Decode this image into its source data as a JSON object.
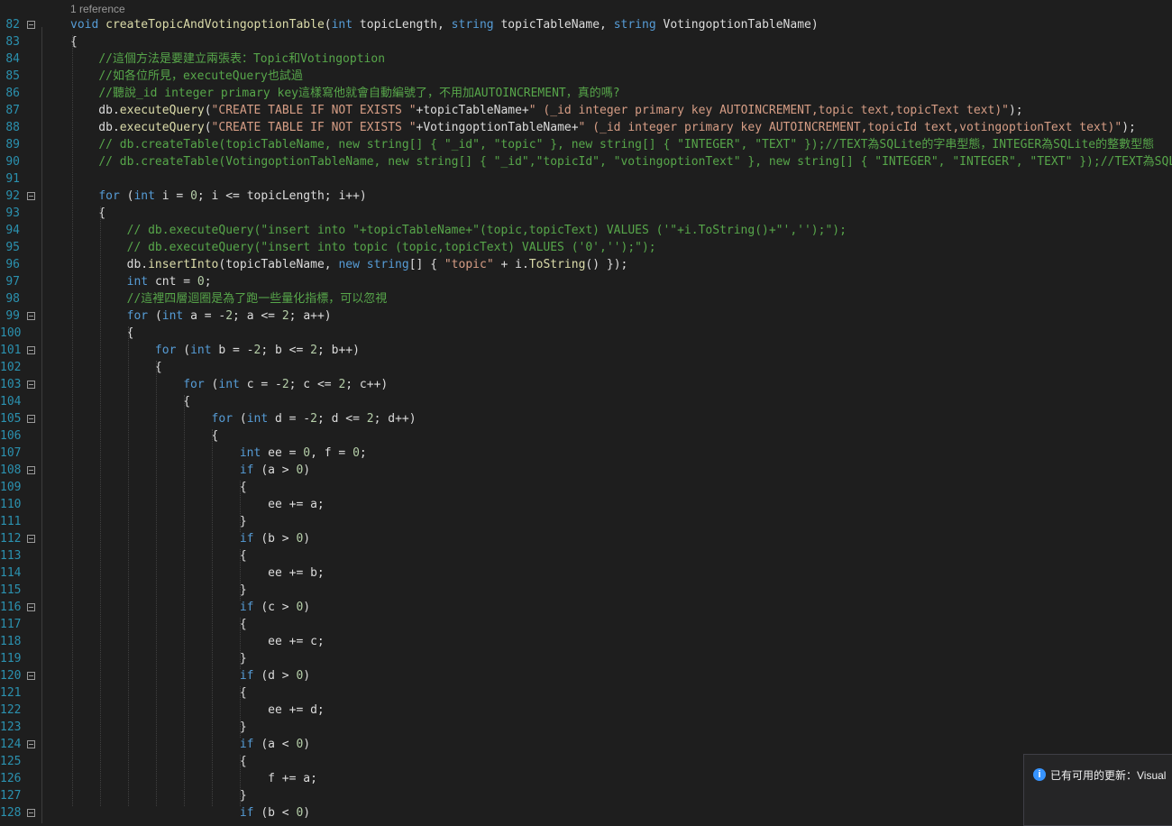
{
  "codelens": "1 reference",
  "icons": {
    "fold": "collapse-minus-icon",
    "info": "info-icon"
  },
  "notification": {
    "text": "已有可用的更新：Visual"
  },
  "lines": [
    {
      "num": "82",
      "fold": true,
      "tokens": [
        {
          "k": "k",
          "t": "void "
        },
        {
          "k": "m",
          "t": "createTopicAndVotingoptionTable"
        },
        {
          "k": "i",
          "t": "("
        },
        {
          "k": "k",
          "t": "int "
        },
        {
          "k": "i",
          "t": "topicLength, "
        },
        {
          "k": "k",
          "t": "string "
        },
        {
          "k": "i",
          "t": "topicTableName, "
        },
        {
          "k": "k",
          "t": "string "
        },
        {
          "k": "i",
          "t": "VotingoptionTableName)"
        }
      ]
    },
    {
      "num": "83",
      "fold": false,
      "tokens": [
        {
          "k": "i",
          "t": "{"
        }
      ]
    },
    {
      "num": "84",
      "fold": false,
      "tokens": [
        {
          "k": "i",
          "t": "    "
        },
        {
          "k": "c",
          "t": "//這個方法是要建立兩張表：Topic和Votingoption"
        }
      ]
    },
    {
      "num": "85",
      "fold": false,
      "tokens": [
        {
          "k": "i",
          "t": "    "
        },
        {
          "k": "c",
          "t": "//如各位所見，executeQuery也試過"
        }
      ]
    },
    {
      "num": "86",
      "fold": false,
      "tokens": [
        {
          "k": "i",
          "t": "    "
        },
        {
          "k": "c",
          "t": "//聽說_id integer primary key這樣寫他就會自動編號了，不用加AUTOINCREMENT，真的嗎?"
        }
      ]
    },
    {
      "num": "87",
      "fold": false,
      "tokens": [
        {
          "k": "i",
          "t": "    db."
        },
        {
          "k": "m",
          "t": "executeQuery"
        },
        {
          "k": "i",
          "t": "("
        },
        {
          "k": "s",
          "t": "\"CREATE TABLE IF NOT EXISTS \""
        },
        {
          "k": "i",
          "t": "+topicTableName+"
        },
        {
          "k": "s",
          "t": "\" (_id integer primary key AUTOINCREMENT,topic text,topicText text)\""
        },
        {
          "k": "i",
          "t": ");"
        }
      ]
    },
    {
      "num": "88",
      "fold": false,
      "tokens": [
        {
          "k": "i",
          "t": "    db."
        },
        {
          "k": "m",
          "t": "executeQuery"
        },
        {
          "k": "i",
          "t": "("
        },
        {
          "k": "s",
          "t": "\"CREATE TABLE IF NOT EXISTS \""
        },
        {
          "k": "i",
          "t": "+VotingoptionTableName+"
        },
        {
          "k": "s",
          "t": "\" (_id integer primary key AUTOINCREMENT,topicId text,votingoptionText text)\""
        },
        {
          "k": "i",
          "t": ");"
        }
      ]
    },
    {
      "num": "89",
      "fold": false,
      "tokens": [
        {
          "k": "i",
          "t": "    "
        },
        {
          "k": "c",
          "t": "// db.createTable(topicTableName, new string[] { \"_id\", \"topic\" }, new string[] { \"INTEGER\", \"TEXT\" });//TEXT為SQLite的字串型態，INTEGER為SQLite的整數型態"
        }
      ]
    },
    {
      "num": "90",
      "fold": false,
      "tokens": [
        {
          "k": "i",
          "t": "    "
        },
        {
          "k": "c",
          "t": "// db.createTable(VotingoptionTableName, new string[] { \"_id\",\"topicId\", \"votingoptionText\" }, new string[] { \"INTEGER\", \"INTEGER\", \"TEXT\" });//TEXT為SQLite"
        }
      ]
    },
    {
      "num": "91",
      "fold": false,
      "tokens": []
    },
    {
      "num": "92",
      "fold": true,
      "tokens": [
        {
          "k": "i",
          "t": "    "
        },
        {
          "k": "k",
          "t": "for "
        },
        {
          "k": "i",
          "t": "("
        },
        {
          "k": "k",
          "t": "int "
        },
        {
          "k": "i",
          "t": "i = "
        },
        {
          "k": "n",
          "t": "0"
        },
        {
          "k": "i",
          "t": "; i <= topicLength; i++)"
        }
      ]
    },
    {
      "num": "93",
      "fold": false,
      "tokens": [
        {
          "k": "i",
          "t": "    {"
        }
      ]
    },
    {
      "num": "94",
      "fold": false,
      "tokens": [
        {
          "k": "i",
          "t": "        "
        },
        {
          "k": "c",
          "t": "// db.executeQuery(\"insert into \"+topicTableName+\"(topic,topicText) VALUES ('\"+i.ToString()+\"','');\");"
        }
      ]
    },
    {
      "num": "95",
      "fold": false,
      "tokens": [
        {
          "k": "i",
          "t": "        "
        },
        {
          "k": "c",
          "t": "// db.executeQuery(\"insert into topic (topic,topicText) VALUES ('0','');\");"
        }
      ]
    },
    {
      "num": "96",
      "fold": false,
      "tokens": [
        {
          "k": "i",
          "t": "        db."
        },
        {
          "k": "m",
          "t": "insertInto"
        },
        {
          "k": "i",
          "t": "(topicTableName, "
        },
        {
          "k": "k",
          "t": "new string"
        },
        {
          "k": "i",
          "t": "[] { "
        },
        {
          "k": "s",
          "t": "\"topic\""
        },
        {
          "k": "i",
          "t": " + i."
        },
        {
          "k": "m",
          "t": "ToString"
        },
        {
          "k": "i",
          "t": "() });"
        }
      ]
    },
    {
      "num": "97",
      "fold": false,
      "tokens": [
        {
          "k": "i",
          "t": "        "
        },
        {
          "k": "k",
          "t": "int "
        },
        {
          "k": "i",
          "t": "cnt = "
        },
        {
          "k": "n",
          "t": "0"
        },
        {
          "k": "i",
          "t": ";"
        }
      ]
    },
    {
      "num": "98",
      "fold": false,
      "tokens": [
        {
          "k": "i",
          "t": "        "
        },
        {
          "k": "c",
          "t": "//這裡四層迴圈是為了跑一些量化指標，可以忽視"
        }
      ]
    },
    {
      "num": "99",
      "fold": true,
      "tokens": [
        {
          "k": "i",
          "t": "        "
        },
        {
          "k": "k",
          "t": "for "
        },
        {
          "k": "i",
          "t": "("
        },
        {
          "k": "k",
          "t": "int "
        },
        {
          "k": "i",
          "t": "a = -"
        },
        {
          "k": "n",
          "t": "2"
        },
        {
          "k": "i",
          "t": "; a <= "
        },
        {
          "k": "n",
          "t": "2"
        },
        {
          "k": "i",
          "t": "; a++)"
        }
      ]
    },
    {
      "num": "100",
      "fold": false,
      "tokens": [
        {
          "k": "i",
          "t": "        {"
        }
      ]
    },
    {
      "num": "101",
      "fold": true,
      "tokens": [
        {
          "k": "i",
          "t": "            "
        },
        {
          "k": "k",
          "t": "for "
        },
        {
          "k": "i",
          "t": "("
        },
        {
          "k": "k",
          "t": "int "
        },
        {
          "k": "i",
          "t": "b = -"
        },
        {
          "k": "n",
          "t": "2"
        },
        {
          "k": "i",
          "t": "; b <= "
        },
        {
          "k": "n",
          "t": "2"
        },
        {
          "k": "i",
          "t": "; b++)"
        }
      ]
    },
    {
      "num": "102",
      "fold": false,
      "tokens": [
        {
          "k": "i",
          "t": "            {"
        }
      ]
    },
    {
      "num": "103",
      "fold": true,
      "tokens": [
        {
          "k": "i",
          "t": "                "
        },
        {
          "k": "k",
          "t": "for "
        },
        {
          "k": "i",
          "t": "("
        },
        {
          "k": "k",
          "t": "int "
        },
        {
          "k": "i",
          "t": "c = -"
        },
        {
          "k": "n",
          "t": "2"
        },
        {
          "k": "i",
          "t": "; c <= "
        },
        {
          "k": "n",
          "t": "2"
        },
        {
          "k": "i",
          "t": "; c++)"
        }
      ]
    },
    {
      "num": "104",
      "fold": false,
      "tokens": [
        {
          "k": "i",
          "t": "                {"
        }
      ]
    },
    {
      "num": "105",
      "fold": true,
      "tokens": [
        {
          "k": "i",
          "t": "                    "
        },
        {
          "k": "k",
          "t": "for "
        },
        {
          "k": "i",
          "t": "("
        },
        {
          "k": "k",
          "t": "int "
        },
        {
          "k": "i",
          "t": "d = -"
        },
        {
          "k": "n",
          "t": "2"
        },
        {
          "k": "i",
          "t": "; d <= "
        },
        {
          "k": "n",
          "t": "2"
        },
        {
          "k": "i",
          "t": "; d++)"
        }
      ]
    },
    {
      "num": "106",
      "fold": false,
      "tokens": [
        {
          "k": "i",
          "t": "                    {"
        }
      ]
    },
    {
      "num": "107",
      "fold": false,
      "tokens": [
        {
          "k": "i",
          "t": "                        "
        },
        {
          "k": "k",
          "t": "int "
        },
        {
          "k": "i",
          "t": "ee = "
        },
        {
          "k": "n",
          "t": "0"
        },
        {
          "k": "i",
          "t": ", f = "
        },
        {
          "k": "n",
          "t": "0"
        },
        {
          "k": "i",
          "t": ";"
        }
      ]
    },
    {
      "num": "108",
      "fold": true,
      "tokens": [
        {
          "k": "i",
          "t": "                        "
        },
        {
          "k": "k",
          "t": "if "
        },
        {
          "k": "i",
          "t": "(a > "
        },
        {
          "k": "n",
          "t": "0"
        },
        {
          "k": "i",
          "t": ")"
        }
      ]
    },
    {
      "num": "109",
      "fold": false,
      "tokens": [
        {
          "k": "i",
          "t": "                        {"
        }
      ]
    },
    {
      "num": "110",
      "fold": false,
      "tokens": [
        {
          "k": "i",
          "t": "                            ee += a;"
        }
      ]
    },
    {
      "num": "111",
      "fold": false,
      "tokens": [
        {
          "k": "i",
          "t": "                        }"
        }
      ]
    },
    {
      "num": "112",
      "fold": true,
      "tokens": [
        {
          "k": "i",
          "t": "                        "
        },
        {
          "k": "k",
          "t": "if "
        },
        {
          "k": "i",
          "t": "(b > "
        },
        {
          "k": "n",
          "t": "0"
        },
        {
          "k": "i",
          "t": ")"
        }
      ]
    },
    {
      "num": "113",
      "fold": false,
      "tokens": [
        {
          "k": "i",
          "t": "                        {"
        }
      ]
    },
    {
      "num": "114",
      "fold": false,
      "tokens": [
        {
          "k": "i",
          "t": "                            ee += b;"
        }
      ]
    },
    {
      "num": "115",
      "fold": false,
      "tokens": [
        {
          "k": "i",
          "t": "                        }"
        }
      ]
    },
    {
      "num": "116",
      "fold": true,
      "tokens": [
        {
          "k": "i",
          "t": "                        "
        },
        {
          "k": "k",
          "t": "if "
        },
        {
          "k": "i",
          "t": "(c > "
        },
        {
          "k": "n",
          "t": "0"
        },
        {
          "k": "i",
          "t": ")"
        }
      ]
    },
    {
      "num": "117",
      "fold": false,
      "tokens": [
        {
          "k": "i",
          "t": "                        {"
        }
      ]
    },
    {
      "num": "118",
      "fold": false,
      "tokens": [
        {
          "k": "i",
          "t": "                            ee += c;"
        }
      ]
    },
    {
      "num": "119",
      "fold": false,
      "tokens": [
        {
          "k": "i",
          "t": "                        }"
        }
      ]
    },
    {
      "num": "120",
      "fold": true,
      "tokens": [
        {
          "k": "i",
          "t": "                        "
        },
        {
          "k": "k",
          "t": "if "
        },
        {
          "k": "i",
          "t": "(d > "
        },
        {
          "k": "n",
          "t": "0"
        },
        {
          "k": "i",
          "t": ")"
        }
      ]
    },
    {
      "num": "121",
      "fold": false,
      "tokens": [
        {
          "k": "i",
          "t": "                        {"
        }
      ]
    },
    {
      "num": "122",
      "fold": false,
      "tokens": [
        {
          "k": "i",
          "t": "                            ee += d;"
        }
      ]
    },
    {
      "num": "123",
      "fold": false,
      "tokens": [
        {
          "k": "i",
          "t": "                        }"
        }
      ]
    },
    {
      "num": "124",
      "fold": true,
      "tokens": [
        {
          "k": "i",
          "t": "                        "
        },
        {
          "k": "k",
          "t": "if "
        },
        {
          "k": "i",
          "t": "(a < "
        },
        {
          "k": "n",
          "t": "0"
        },
        {
          "k": "i",
          "t": ")"
        }
      ]
    },
    {
      "num": "125",
      "fold": false,
      "tokens": [
        {
          "k": "i",
          "t": "                        {"
        }
      ]
    },
    {
      "num": "126",
      "fold": false,
      "tokens": [
        {
          "k": "i",
          "t": "                            f += a;"
        }
      ]
    },
    {
      "num": "127",
      "fold": false,
      "tokens": [
        {
          "k": "i",
          "t": "                        }"
        }
      ]
    },
    {
      "num": "128",
      "fold": true,
      "tokens": [
        {
          "k": "i",
          "t": "                        "
        },
        {
          "k": "k",
          "t": "if "
        },
        {
          "k": "i",
          "t": "(b < "
        },
        {
          "k": "n",
          "t": "0"
        },
        {
          "k": "i",
          "t": ")"
        }
      ]
    }
  ]
}
